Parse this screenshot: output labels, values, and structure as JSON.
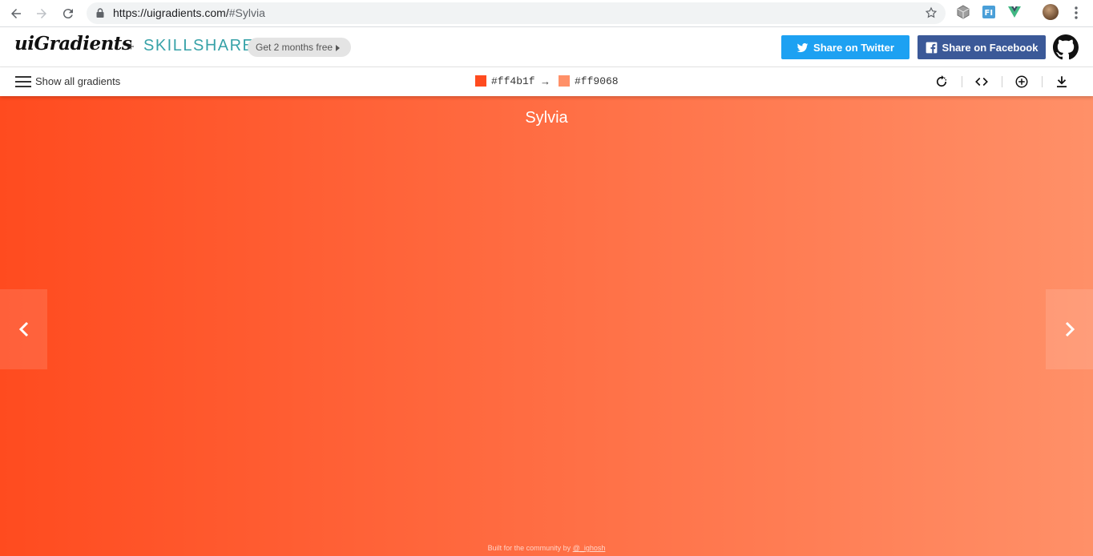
{
  "browser": {
    "url_host": "https://uigradients.com/",
    "url_hash": "#Sylvia",
    "extensions": [
      "cube-extension-icon",
      "fi-extension-icon",
      "vue-devtools-icon"
    ]
  },
  "header": {
    "logo": "uiGradients",
    "plus": "+",
    "partner": "SKILLSHARE",
    "promo_label": "Get 2 months free",
    "twitter_label": "Share on Twitter",
    "facebook_label": "Share on Facebook",
    "twitter_color": "#1da1f2",
    "facebook_color": "#3b5998",
    "partner_color": "#37a2a8"
  },
  "toolbar": {
    "show_all_label": "Show all gradients",
    "color_from": "#ff4b1f",
    "color_to": "#ff9068",
    "arrow": "→",
    "tools": [
      "rotate-icon",
      "code-icon",
      "add-icon",
      "download-icon"
    ]
  },
  "gradient": {
    "name": "Sylvia",
    "direction": "to right",
    "footer_prefix": "Built for the community by",
    "footer_handle": "@_ighosh"
  }
}
